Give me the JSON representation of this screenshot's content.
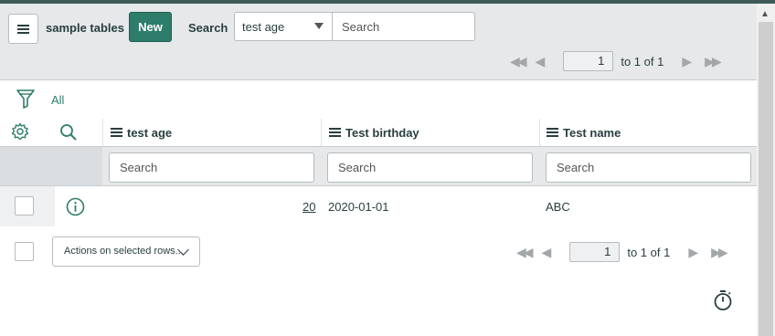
{
  "header": {
    "menu_icon": "hamburger-icon",
    "title": "sample tables",
    "new_label": "New",
    "search_label": "Search",
    "search_field_selected": "test age",
    "search_placeholder": "Search",
    "pager": {
      "page": "1",
      "range_text": "to 1 of 1"
    }
  },
  "filter": {
    "icon": "funnel-icon",
    "breadcrumb_all": "All"
  },
  "columns": [
    {
      "label": "test age",
      "search_placeholder": "Search"
    },
    {
      "label": "Test birthday",
      "search_placeholder": "Search"
    },
    {
      "label": "Test name",
      "search_placeholder": "Search"
    }
  ],
  "toolbar_icons": {
    "settings": "gear-icon",
    "search": "magnifier-icon"
  },
  "rows": [
    {
      "test_age": "20",
      "test_birthday": "2020-01-01",
      "test_name": "ABC",
      "info_icon": "info-icon"
    }
  ],
  "footer": {
    "actions_label": "Actions on selected rows...",
    "pager": {
      "page": "1",
      "range_text": "to 1 of 1"
    },
    "timer_icon": "stopwatch-icon"
  },
  "colors": {
    "accent": "#2e7d6b",
    "header_bg": "#e6e8ea"
  }
}
